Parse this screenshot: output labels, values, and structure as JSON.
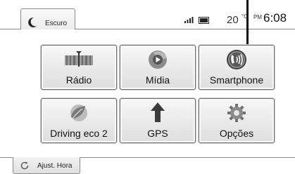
{
  "header": {
    "mode_label": "Escuro",
    "temperature": "20",
    "temperature_unit": "°C",
    "ampm": "PM",
    "time": "6:08"
  },
  "tiles": [
    {
      "label": "Rádio",
      "icon": "radio-icon"
    },
    {
      "label": "Mídia",
      "icon": "media-play-icon"
    },
    {
      "label": "Smartphone",
      "icon": "smartphone-voice-icon"
    },
    {
      "label": "Driving eco 2",
      "icon": "eco-leaf-icon"
    },
    {
      "label": "GPS",
      "icon": "navigation-arrow-icon"
    },
    {
      "label": "Opções",
      "icon": "gear-icon"
    }
  ],
  "footer": {
    "adjust_label": "Ajust. Hora"
  }
}
